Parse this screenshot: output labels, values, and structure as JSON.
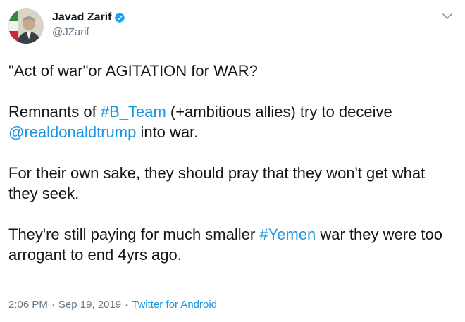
{
  "author": {
    "display_name": "Javad Zarif",
    "handle": "@JZarif",
    "verified": true
  },
  "tweet": {
    "paragraphs": [
      [
        {
          "text": "\"Act of war\"or AGITATION for WAR?",
          "type": "text"
        }
      ],
      [
        {
          "text": "Remnants of ",
          "type": "text"
        },
        {
          "text": "#B_Team",
          "type": "hashtag"
        },
        {
          "text": " (+ambitious allies) try to deceive ",
          "type": "text"
        },
        {
          "text": "@realdonaldtrump",
          "type": "mention"
        },
        {
          "text": " into war.",
          "type": "text"
        }
      ],
      [
        {
          "text": "For their own sake, they should pray that they won't get what they seek.",
          "type": "text"
        }
      ],
      [
        {
          "text": "They're still paying for much smaller ",
          "type": "text"
        },
        {
          "text": "#Yemen",
          "type": "hashtag"
        },
        {
          "text": " war they were too arrogant to end 4yrs ago.",
          "type": "text"
        }
      ]
    ]
  },
  "meta": {
    "time": "2:06 PM",
    "date": "Sep 19, 2019",
    "separator": "·",
    "source": "Twitter for Android"
  },
  "icons": {
    "verified": "verified-badge-icon",
    "caret": "chevron-down-icon"
  },
  "colors": {
    "link": "#1b95e0",
    "secondary_text": "#657786",
    "primary_text": "#14171a"
  }
}
